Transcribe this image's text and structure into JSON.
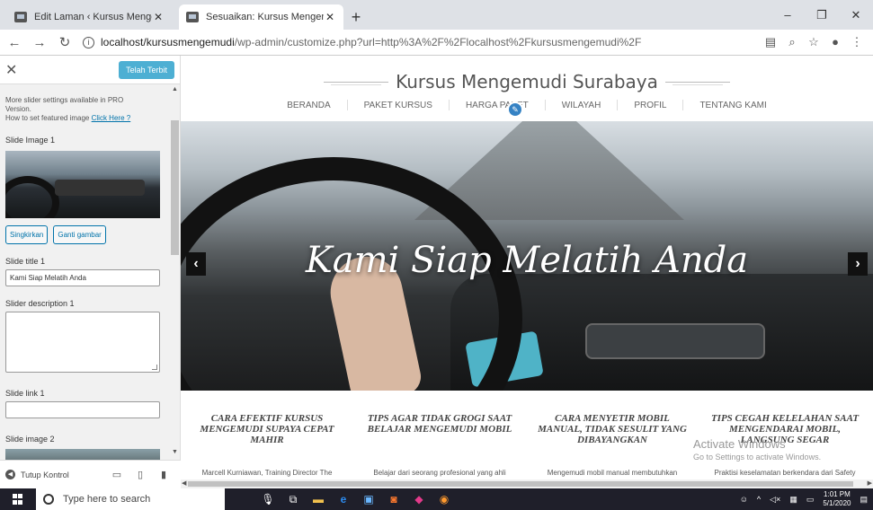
{
  "browser": {
    "tabs": [
      {
        "title": "Edit Laman ‹ Kursus Mengemudi",
        "active": false
      },
      {
        "title": "Sesuaikan: Kursus Mengemudi S",
        "active": true
      }
    ],
    "new_tab": "+",
    "url_host": "localhost/kursusmengemudi",
    "url_path": "/wp-admin/customize.php?url=http%3A%2F%2Flocalhost%2Fkursusmengemudi%2F",
    "window_controls": {
      "minimize": "–",
      "restore": "❐",
      "close": "✕"
    }
  },
  "customizer": {
    "close_symbol": "✕",
    "published_label": "Telah Terbit",
    "note_line1": "More slider settings available in PRO",
    "note_line2": "Version.",
    "note_line3": "How to set featured image",
    "note_link": "Click Here ?",
    "slide_image_1_label": "Slide Image 1",
    "remove_button": "Singkirkan",
    "change_image_button": "Ganti gambar",
    "slide_title_1_label": "Slide title 1",
    "slide_title_1_value": "Kami Siap Melatih Anda",
    "slider_description_1_label": "Slider description 1",
    "slide_link_1_label": "Slide link 1",
    "slide_image_2_label": "Slide image 2",
    "hide_controls_label": "Tutup Kontrol"
  },
  "site": {
    "title": "Kursus Mengemudi Surabaya",
    "menu": [
      "BERANDA",
      "PAKET KURSUS",
      "HARGA PAKET",
      "WILAYAH",
      "PROFIL",
      "TENTANG KAMI"
    ],
    "hero_caption": "Kami Siap Melatih Anda",
    "slider_prev": "‹",
    "slider_next": "›",
    "slider_dots": {
      "active_color": "#f5c518",
      "inactive_color": "#e8a0b0"
    },
    "posts": [
      {
        "title": "CARA EFEKTIF KURSUS MENGEMUDI SUPAYA CEPAT MAHIR",
        "excerpt": "Marcell Kurniawan, Training Director The"
      },
      {
        "title": "TIPS AGAR TIDAK GROGI SAAT BELAJAR MENGEMUDI MOBIL",
        "excerpt": "Belajar dari seorang profesional yang ahli"
      },
      {
        "title": "CARA MENYETIR MOBIL MANUAL, TIDAK SESULIT YANG DIBAYANGKAN",
        "excerpt": "Mengemudi mobil manual membutuhkan"
      },
      {
        "title": "TIPS CEGAH KELELAHAN SAAT MENGENDARAI MOBIL, LANGSUNG SEGAR",
        "excerpt": "Praktisi keselamatan berkendara dari Safety"
      }
    ],
    "activate_title": "Activate Windows",
    "activate_sub": "Go to Settings to activate Windows."
  },
  "taskbar": {
    "search_placeholder": "Type here to search",
    "time": "1:01 PM",
    "date": "5/1/2020"
  },
  "colors": {
    "accent": "#0073aa",
    "published_bg": "#2ea2cc",
    "edit_pen": "#3582c4"
  }
}
